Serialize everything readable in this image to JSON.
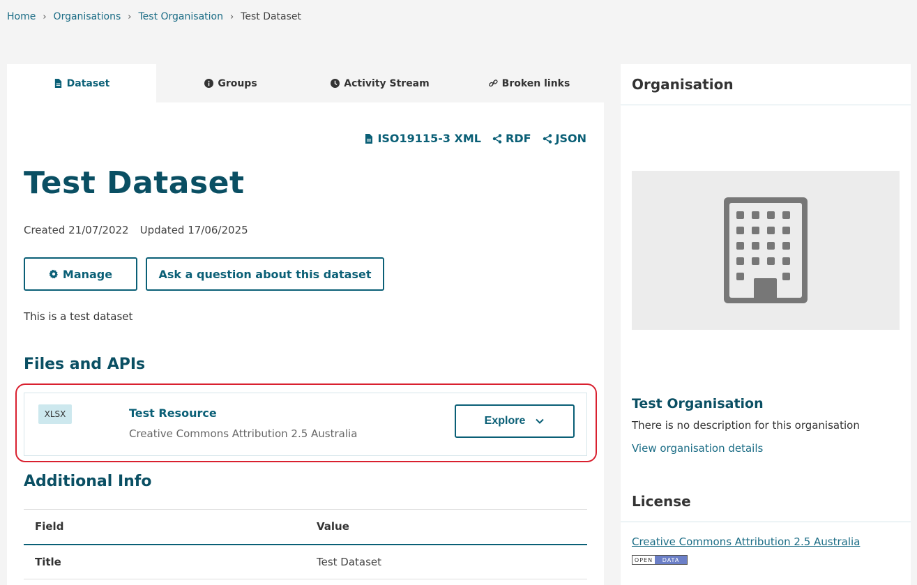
{
  "breadcrumb": {
    "items": [
      "Home",
      "Organisations",
      "Test Organisation"
    ],
    "current": "Test Dataset",
    "separator": "›"
  },
  "tabs": [
    {
      "label": "Dataset",
      "icon": "file-icon",
      "active": true
    },
    {
      "label": "Groups",
      "icon": "info-icon",
      "active": false
    },
    {
      "label": "Activity Stream",
      "icon": "clock-icon",
      "active": false
    },
    {
      "label": "Broken links",
      "icon": "link-icon",
      "active": false
    }
  ],
  "formats": {
    "iso": "ISO19115-3 XML",
    "rdf": "RDF",
    "json": "JSON"
  },
  "dataset": {
    "title": "Test Dataset",
    "created": "Created 21/07/2022",
    "updated": "Updated 17/06/2025",
    "manage_label": "Manage",
    "ask_label": "Ask a question about this dataset",
    "description": "This is a test dataset"
  },
  "files": {
    "heading": "Files and APIs",
    "resources": [
      {
        "format": "XLSX",
        "name": "Test Resource",
        "license": "Creative Commons Attribution 2.5 Australia",
        "explore_label": "Explore"
      }
    ]
  },
  "additional_info": {
    "heading": "Additional Info",
    "columns": [
      "Field",
      "Value"
    ],
    "rows": [
      {
        "field": "Title",
        "value": "Test Dataset"
      }
    ]
  },
  "sidebar": {
    "organisation_heading": "Organisation",
    "org_name": "Test Organisation",
    "org_description": "There is no description for this organisation",
    "org_link": "View organisation details",
    "license_heading": "License",
    "license_link": "Creative Commons Attribution 2.5 Australia",
    "open_data_badge": {
      "open": "OPEN",
      "data": "DATA"
    }
  },
  "colors": {
    "accent": "#0a5f76",
    "highlight": "#d9202f",
    "background": "#f4f4f4"
  }
}
